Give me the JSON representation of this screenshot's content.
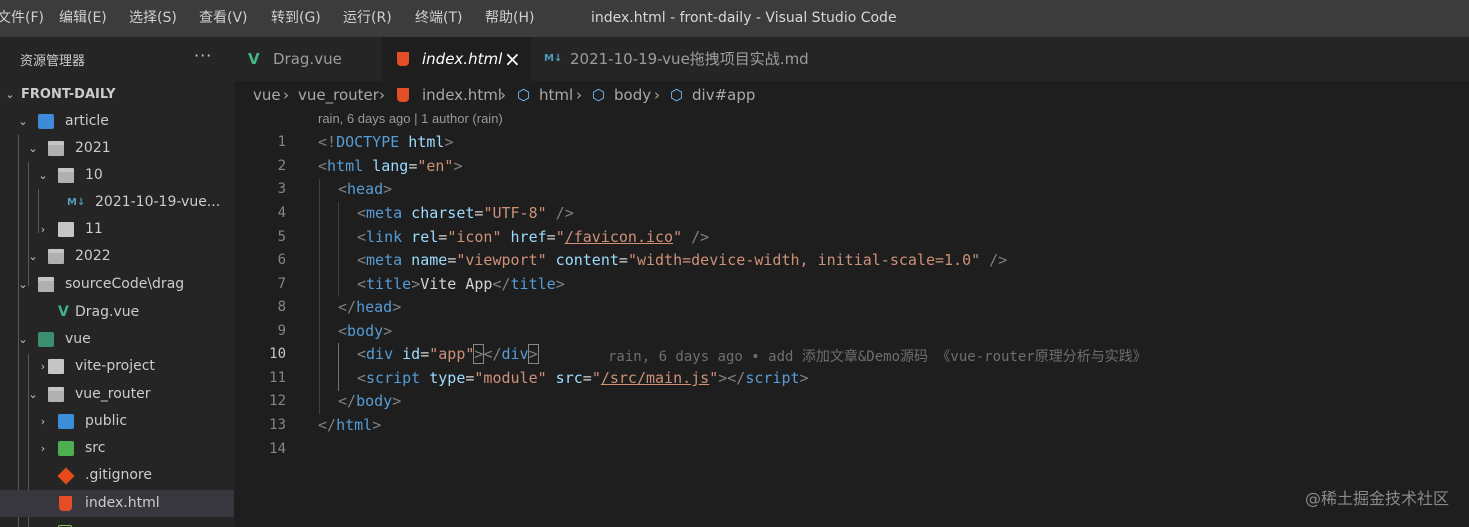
{
  "menu": {
    "items": [
      "文件(F)",
      "编辑(E)",
      "选择(S)",
      "查看(V)",
      "转到(G)",
      "运行(R)",
      "终端(T)",
      "帮助(H)"
    ]
  },
  "window_title": "index.html - front-daily - Visual Studio Code",
  "explorer": {
    "title": "资源管理器",
    "more": "···",
    "root": "FRONT-DAILY",
    "items": [
      {
        "label": "article",
        "icon": "folder-article-icon"
      },
      {
        "label": "2021",
        "icon": "folder-icon"
      },
      {
        "label": "10",
        "icon": "folder-icon"
      },
      {
        "label": "2021-10-19-vue...",
        "icon": "markdown-icon"
      },
      {
        "label": "11",
        "icon": "folder-icon"
      },
      {
        "label": "2022",
        "icon": "folder-icon"
      },
      {
        "label": "sourceCode\\drag",
        "icon": "folder-icon"
      },
      {
        "label": "Drag.vue",
        "icon": "vue-icon"
      },
      {
        "label": "vue",
        "icon": "folder-vue-icon"
      },
      {
        "label": "vite-project",
        "icon": "folder-icon"
      },
      {
        "label": "vue_router",
        "icon": "folder-icon"
      },
      {
        "label": "public",
        "icon": "folder-public-icon"
      },
      {
        "label": "src",
        "icon": "folder-src-icon"
      },
      {
        "label": ".gitignore",
        "icon": "git-icon"
      },
      {
        "label": "index.html",
        "icon": "html-icon"
      }
    ]
  },
  "tabs": [
    {
      "label": "Drag.vue",
      "icon": "vue-icon"
    },
    {
      "label": "index.html",
      "icon": "html-icon",
      "close": "×"
    },
    {
      "label": "2021-10-19-vue拖拽项目实战.md",
      "icon": "markdown-icon"
    }
  ],
  "breadcrumb": [
    "vue",
    "vue_router",
    "index.html",
    "html",
    "body",
    "div#app"
  ],
  "breadcrumb_sep": "›",
  "codelens": "rain, 6 days ago | 1 author (rain)",
  "line_numbers": [
    "1",
    "2",
    "3",
    "4",
    "5",
    "6",
    "7",
    "8",
    "9",
    "10",
    "11",
    "12",
    "13",
    "14"
  ],
  "code": {
    "l1": {
      "a": "<!",
      "b": "DOCTYPE",
      "c": " html",
      "d": ">"
    },
    "l2": {
      "a": "<",
      "b": "html",
      "c": " lang",
      "d": "=",
      "e": "\"en\"",
      "f": ">"
    },
    "l3": {
      "a": "<",
      "b": "head",
      "c": ">"
    },
    "l4": {
      "a": "<",
      "b": "meta",
      "c": " charset",
      "d": "=",
      "e": "\"UTF-8\"",
      "f": " />"
    },
    "l5": {
      "a": "<",
      "b": "link",
      "c": " rel",
      "d": "=",
      "e": "\"icon\"",
      "f": " href",
      "g": "=",
      "h": "\"",
      "i": "/favicon.ico",
      "j": "\"",
      "k": " />"
    },
    "l6": {
      "a": "<",
      "b": "meta",
      "c": " name",
      "d": "=",
      "e": "\"viewport\"",
      "f": " content",
      "g": "=",
      "h": "\"width=device-width, initial-scale=1.0\"",
      "i": " />"
    },
    "l7": {
      "a": "<",
      "b": "title",
      "c": ">",
      "d": "Vite App",
      "e": "</",
      "f": "title",
      "g": ">"
    },
    "l8": {
      "a": "</",
      "b": "head",
      "c": ">"
    },
    "l9": {
      "a": "<",
      "b": "body",
      "c": ">"
    },
    "l10": {
      "a": "<",
      "b": "div",
      "c": " id",
      "d": "=",
      "e": "\"app\"",
      "f": ">",
      "g": "</",
      "h": "div",
      "i": ">"
    },
    "l11": {
      "a": "<",
      "b": "script",
      "c": " type",
      "d": "=",
      "e": "\"module\"",
      "f": " src",
      "g": "=",
      "h": "\"",
      "i": "/src/main.js",
      "j": "\"",
      "k": "></",
      "l": "script",
      "m": ">"
    },
    "l12": {
      "a": "</",
      "b": "body",
      "c": ">"
    },
    "l13": {
      "a": "</",
      "b": "html",
      "c": ">"
    }
  },
  "blame": "rain, 6 days ago • add 添加文章&Demo源码 《vue-router原理分析与实践》",
  "watermark": "@稀土掘金技术社区",
  "colors": {
    "accent": "#007acc",
    "html_orange": "#e44d26",
    "vue_green": "#41b883",
    "md_blue": "#519aba"
  }
}
